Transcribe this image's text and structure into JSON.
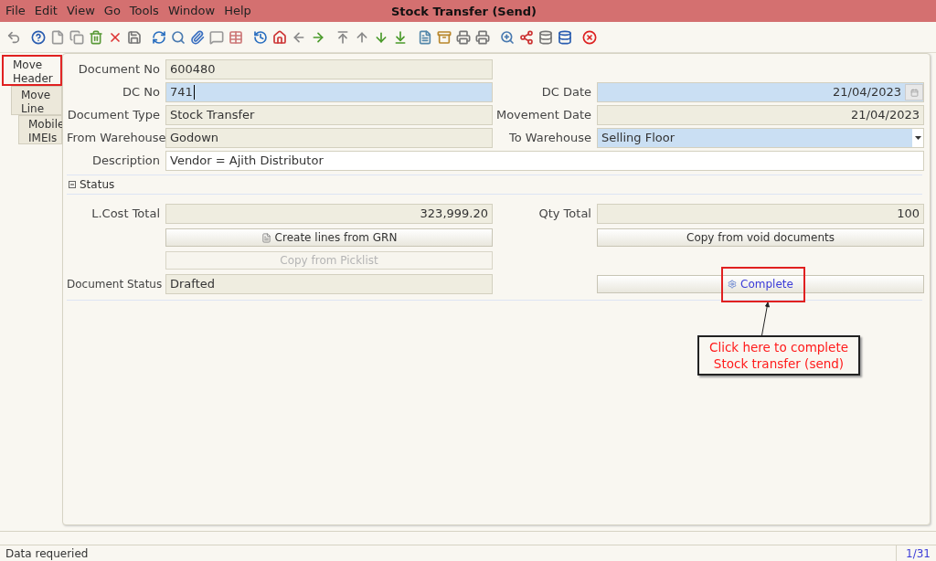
{
  "window": {
    "title": "Stock Transfer (Send)"
  },
  "menu": [
    "File",
    "Edit",
    "View",
    "Go",
    "Tools",
    "Window",
    "Help"
  ],
  "tabs": [
    {
      "label": "Move Header",
      "selected": true,
      "highlighted": true
    },
    {
      "label": "Move Line",
      "selected": false,
      "highlighted": false
    },
    {
      "label": "Mobile IMEIs",
      "selected": false,
      "highlighted": false
    }
  ],
  "left_fields": [
    {
      "label": "Document No",
      "value": "600480",
      "kind": "readonly"
    },
    {
      "label": "DC No",
      "value": "741",
      "kind": "focused"
    },
    {
      "label": "Document Type",
      "value": "Stock Transfer",
      "kind": "readonly"
    },
    {
      "label": "From Warehouse",
      "value": "Godown",
      "kind": "readonly"
    }
  ],
  "right_fields": [
    {
      "label": "DC Date",
      "value": "21/04/2023",
      "kind": "date"
    },
    {
      "label": "Movement Date",
      "value": "21/04/2023",
      "kind": "readonly-right"
    },
    {
      "label": "To Warehouse",
      "value": "Selling Floor",
      "kind": "select"
    }
  ],
  "description": {
    "label": "Description",
    "value": "Vendor = Ajith Distributor"
  },
  "status_section": {
    "label": "Status",
    "expanded": true
  },
  "totals": [
    {
      "label": "L.Cost Total",
      "value": "323,999.20"
    },
    {
      "label": "Qty Total",
      "value": "100"
    }
  ],
  "buttons": [
    {
      "label": "Create lines from GRN",
      "disabled": false
    },
    {
      "label": "Copy from void documents",
      "disabled": false
    },
    {
      "label": "Copy from Picklist",
      "disabled": true
    }
  ],
  "document_status": {
    "label": "Document Status",
    "value": "Drafted"
  },
  "complete_button": {
    "label": "Complete",
    "disabled": false,
    "highlighted": true
  },
  "callout": {
    "text": "Click here to complete Stock transfer (send)"
  },
  "status_bar": {
    "message": "Data requeried",
    "record": "1/31"
  }
}
